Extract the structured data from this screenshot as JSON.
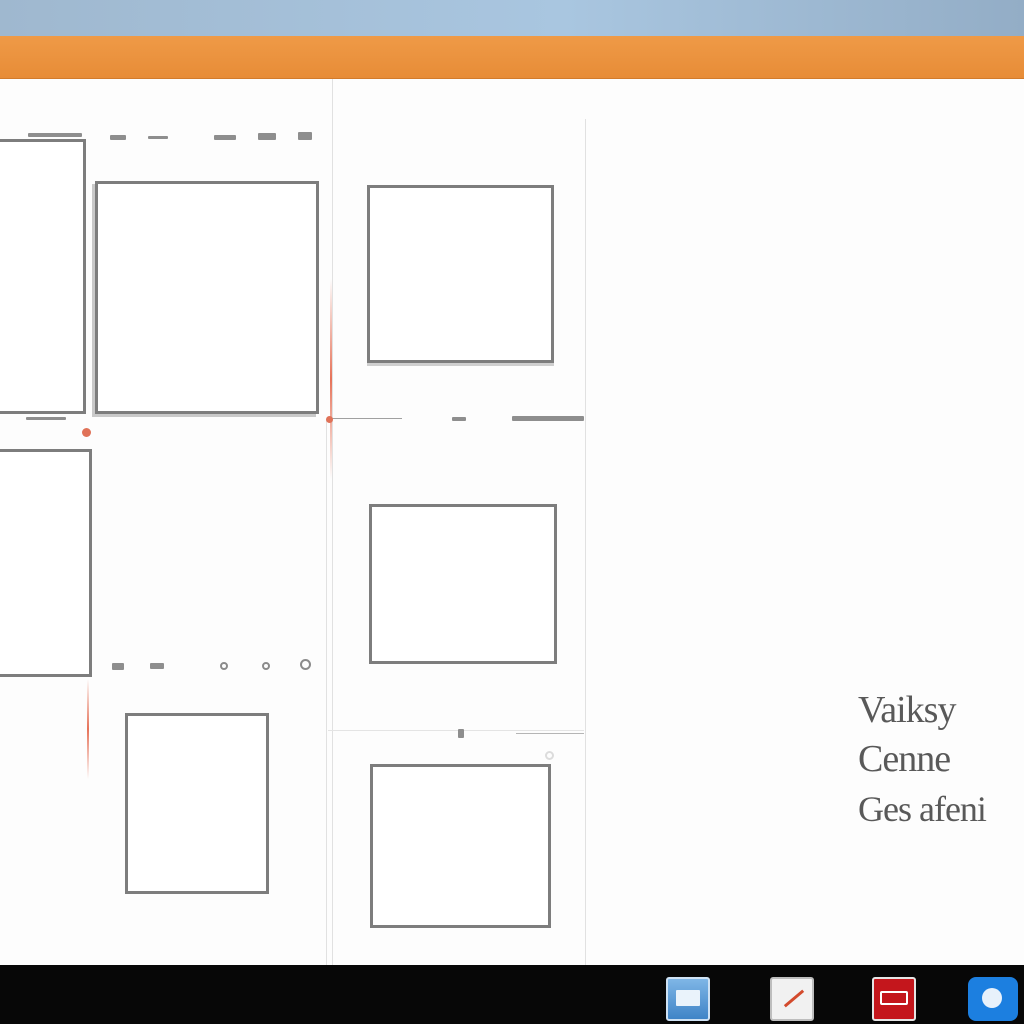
{
  "window": {
    "title_bar_color": "#a9c6e0",
    "ribbon_color": "#e78c37"
  },
  "layout_panels": {
    "frames": [
      {
        "id": "frame-a",
        "kind": "image-placeholder"
      },
      {
        "id": "frame-b",
        "kind": "image-placeholder"
      },
      {
        "id": "frame-c",
        "kind": "image-placeholder"
      },
      {
        "id": "frame-d",
        "kind": "image-placeholder"
      },
      {
        "id": "frame-e",
        "kind": "image-placeholder"
      },
      {
        "id": "frame-f",
        "kind": "image-placeholder"
      },
      {
        "id": "frame-g",
        "kind": "image-placeholder"
      }
    ],
    "guide_color": "#e25a3c",
    "frame_border_color": "#7d7d7d"
  },
  "side_text": {
    "line1": "Vaiksy",
    "line2": "Cenne",
    "line3": "Ges afeni"
  },
  "taskbar": {
    "background": "#070707",
    "apps": [
      {
        "icon": "mail-icon"
      },
      {
        "icon": "drawing-app-icon"
      },
      {
        "icon": "red-app-icon"
      },
      {
        "icon": "blue-circle-app-icon"
      }
    ]
  }
}
